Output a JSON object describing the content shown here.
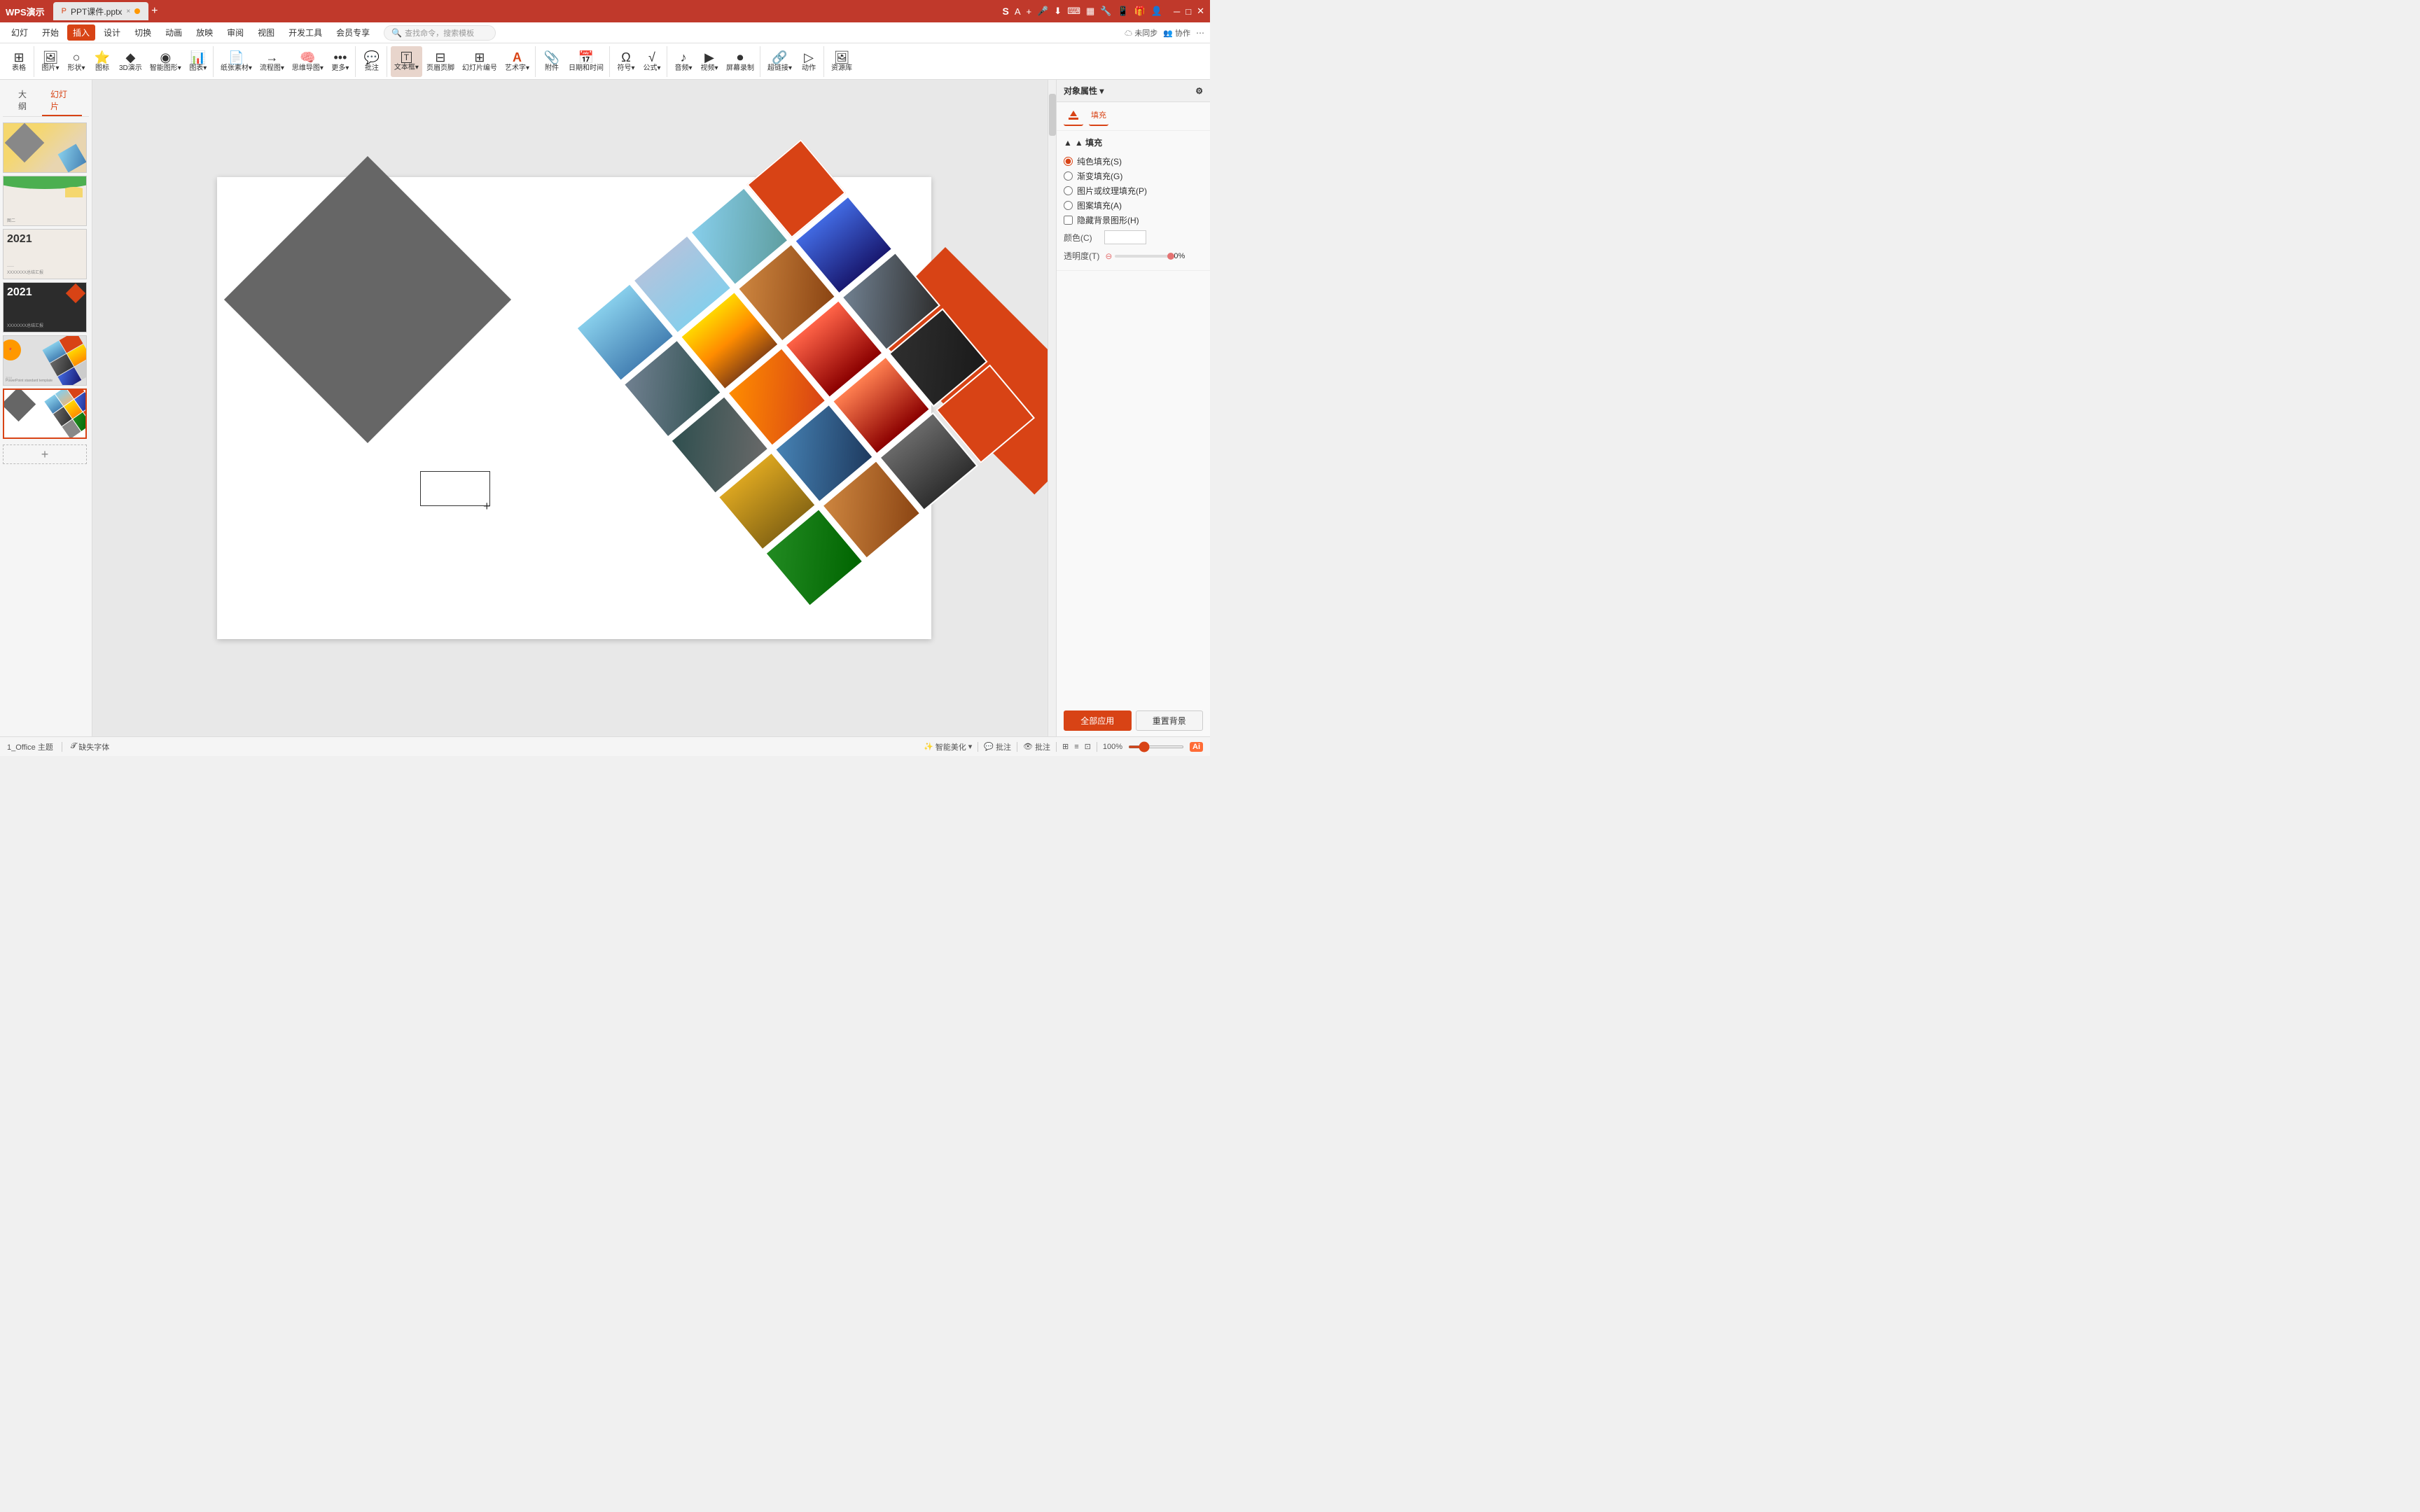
{
  "app": {
    "title": "WPS演示",
    "tab_label": "PPT课件.pptx",
    "tab_close": "×",
    "tab_new": "+"
  },
  "title_icons": [
    "S",
    "A",
    "+",
    "🎤",
    "⬇",
    "⌨",
    "📊",
    "🔧",
    "📱",
    "🎁",
    "👤"
  ],
  "menu": {
    "items": [
      "幻灯",
      "开始",
      "插入",
      "设计",
      "切换",
      "动画",
      "放映",
      "审阅",
      "视图",
      "开发工具",
      "会员专享"
    ],
    "search_placeholder": "查找命令，搜索模板",
    "active": "插入",
    "right_items": [
      "未同步",
      "协作"
    ]
  },
  "toolbar": {
    "groups": [
      {
        "name": "tables",
        "items": [
          {
            "icon": "⊞",
            "label": "表格"
          }
        ]
      },
      {
        "name": "images",
        "items": [
          {
            "icon": "🖼",
            "label": "图片"
          },
          {
            "icon": "○",
            "label": "形状"
          },
          {
            "icon": "⭐",
            "label": "图标"
          },
          {
            "icon": "◆",
            "label": "3D演示"
          },
          {
            "icon": "◉",
            "label": "智能图形"
          },
          {
            "icon": "📊",
            "label": "图表"
          }
        ]
      },
      {
        "name": "slides",
        "items": [
          {
            "icon": "▭",
            "label": "纸张素材"
          },
          {
            "icon": "→",
            "label": "流程图"
          },
          {
            "icon": "🧠",
            "label": "思维导图"
          },
          {
            "icon": "•••",
            "label": "更多"
          }
        ]
      },
      {
        "name": "comment",
        "items": [
          {
            "icon": "💬",
            "label": "批注"
          }
        ]
      },
      {
        "name": "textbox",
        "items": [
          {
            "icon": "T",
            "label": "文本框",
            "active": true
          }
        ]
      },
      {
        "name": "header",
        "items": [
          {
            "icon": "▭",
            "label": "页眉页脚"
          }
        ]
      },
      {
        "name": "art",
        "items": [
          {
            "icon": "A",
            "label": "艺术字"
          }
        ]
      },
      {
        "name": "links",
        "items": [
          {
            "icon": "🔗",
            "label": "附件"
          },
          {
            "icon": "📅",
            "label": "日期和时间"
          }
        ]
      },
      {
        "name": "symbols",
        "items": [
          {
            "icon": "Ω",
            "label": "符号"
          },
          {
            "icon": "√",
            "label": "公式"
          }
        ]
      },
      {
        "name": "media",
        "items": [
          {
            "icon": "♪",
            "label": "音频"
          },
          {
            "icon": "▶",
            "label": "视频"
          },
          {
            "icon": "⏺",
            "label": "屏幕录制"
          }
        ]
      },
      {
        "name": "links2",
        "items": [
          {
            "icon": "🔗",
            "label": "超链接"
          }
        ]
      },
      {
        "name": "actions",
        "items": [
          {
            "icon": "▷",
            "label": "动作"
          }
        ]
      },
      {
        "name": "resources",
        "items": [
          {
            "icon": "🖼",
            "label": "资源库"
          }
        ]
      }
    ]
  },
  "view_tabs": [
    {
      "label": "大纲",
      "active": false
    },
    {
      "label": "幻灯片",
      "active": true
    }
  ],
  "slides": [
    {
      "id": 1,
      "type": "yellow-diamond"
    },
    {
      "id": 2,
      "type": "green-wave"
    },
    {
      "id": 3,
      "type": "text-2021"
    },
    {
      "id": 4,
      "type": "dark-2021"
    },
    {
      "id": 5,
      "type": "city-grid"
    },
    {
      "id": 6,
      "type": "orange-city",
      "active": true
    }
  ],
  "canvas": {
    "slide_number": "1_Office 主题",
    "missing_font_label": "缺失字体"
  },
  "right_panel": {
    "title": "对象属性 ▾",
    "icon_label": "填充",
    "section_title": "▲ 填充",
    "fill_options": [
      {
        "label": "纯色填充(S)",
        "checked": true
      },
      {
        "label": "渐变填充(G)",
        "checked": false
      },
      {
        "label": "图片或纹理填充(P)",
        "checked": false
      },
      {
        "label": "图案填充(A)",
        "checked": false
      },
      {
        "label": "隐藏背景图形(H)",
        "checked": false,
        "type": "checkbox"
      }
    ],
    "color_label": "颜色(C)",
    "opacity_label": "透明度(T)",
    "opacity_value": "0%",
    "btn_apply_all": "全部应用",
    "btn_reset": "重置背景"
  },
  "status_bar": {
    "slide_info": "1_Office 主题",
    "missing_font": "缺失字体",
    "smart_beauty": "智能美化",
    "comment": "批注",
    "review": "批注",
    "view_icons": [
      "⊞",
      "≡",
      "⊡"
    ],
    "zoom_level": "100%",
    "zoom_label": "100%",
    "ai_label": "Ai"
  },
  "cursor": {
    "symbol": "+"
  }
}
